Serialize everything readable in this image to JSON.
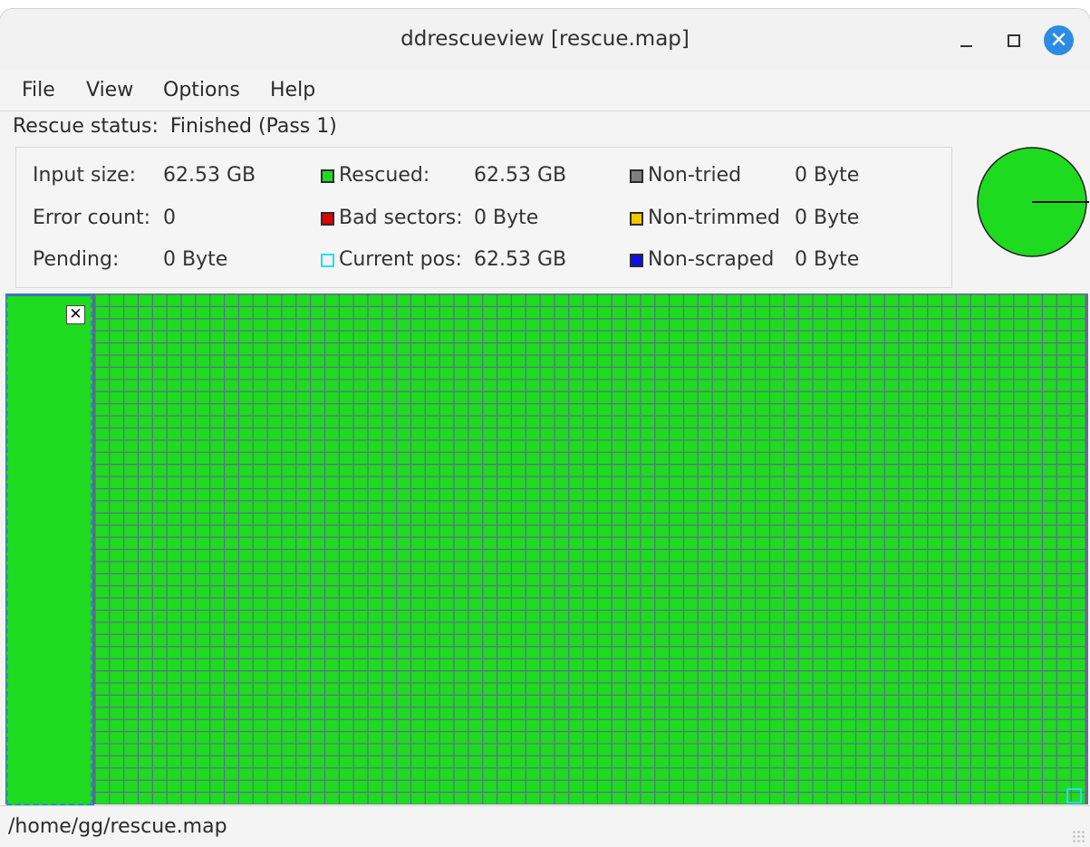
{
  "window": {
    "title": "ddrescueview [rescue.map]"
  },
  "menu": {
    "items": [
      "File",
      "View",
      "Options",
      "Help"
    ]
  },
  "status": {
    "label": "Rescue status:",
    "value": "Finished (Pass 1)"
  },
  "info": {
    "input_size": {
      "label": "Input size:",
      "value": "62.53 GB"
    },
    "error_count": {
      "label": "Error count:",
      "value": "0"
    },
    "pending": {
      "label": "Pending:",
      "value": "0 Byte"
    },
    "rescued": {
      "label": "Rescued:",
      "value": "62.53 GB",
      "color": "#1fdb1f"
    },
    "bad_sectors": {
      "label": "Bad sectors:",
      "value": "0 Byte",
      "color": "#e00000"
    },
    "current_pos": {
      "label": "Current pos:",
      "value": "62.53 GB",
      "color": "#22e0e6"
    },
    "non_tried": {
      "label": "Non-tried",
      "value": "0 Byte",
      "color": "#808080"
    },
    "non_trimmed": {
      "label": "Non-trimmed",
      "value": "0 Byte",
      "color": "#f0c800"
    },
    "non_scraped": {
      "label": "Non-scraped",
      "value": "0 Byte",
      "color": "#1010e0"
    }
  },
  "pie": {
    "rescued_fraction": 1.0,
    "color": "#1fdb1f"
  },
  "blockmap": {
    "state": "all rescued",
    "fill_color": "#1fdb1f",
    "grid_color": "#5f6e8d"
  },
  "sidepanel": {
    "close_icon": "close-icon"
  },
  "statusbar": {
    "path": "/home/gg/rescue.map"
  },
  "icons": {
    "minimize": "minimize-icon",
    "maximize": "maximize-icon",
    "close": "close-icon",
    "resize": "resize-grip-icon"
  },
  "close_glyph": "✕"
}
